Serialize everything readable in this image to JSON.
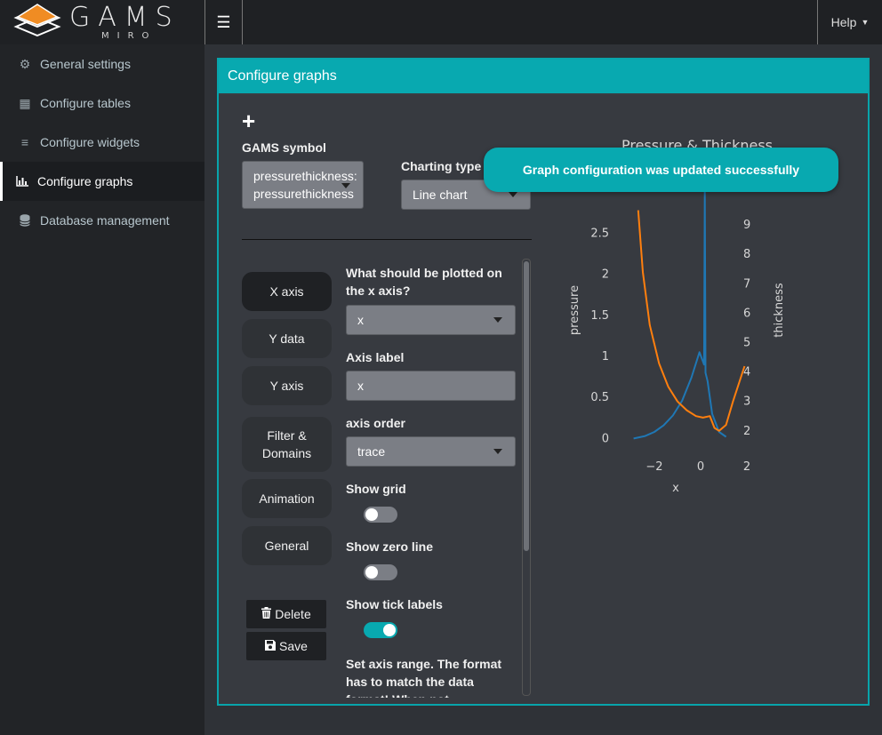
{
  "app": {
    "logo_text": "GAMS",
    "logo_subtext": "MIRO"
  },
  "header": {
    "menu_icon": "hamburger-icon",
    "help_label": "Help"
  },
  "sidebar": {
    "items": [
      {
        "label": "General settings",
        "icon": "gears-icon"
      },
      {
        "label": "Configure tables",
        "icon": "table-icon"
      },
      {
        "label": "Configure widgets",
        "icon": "sliders-icon"
      },
      {
        "label": "Configure graphs",
        "icon": "bar-chart-icon",
        "active": true
      },
      {
        "label": "Database management",
        "icon": "database-icon"
      }
    ]
  },
  "panel": {
    "title": "Configure graphs",
    "add_icon": "+",
    "gams_symbol_label": "GAMS symbol",
    "gams_symbol_value_1": "pressurethickness:",
    "gams_symbol_value_2": "pressurethickness",
    "charting_type_label": "Charting type",
    "charting_type_value": "Line chart"
  },
  "tabs": [
    "X axis",
    "Y data",
    "Y axis",
    "Filter & Domains",
    "Animation",
    "General"
  ],
  "actions": {
    "delete": "Delete",
    "save": "Save"
  },
  "form": {
    "x_axis_question": "What should be plotted on the x axis?",
    "x_axis_value": "x",
    "axis_label_label": "Axis label",
    "axis_label_value": "x",
    "axis_order_label": "axis order",
    "axis_order_value": "trace",
    "show_grid_label": "Show grid",
    "show_grid": false,
    "show_zero_line_label": "Show zero line",
    "show_zero_line": false,
    "show_tick_labels_label": "Show tick labels",
    "show_tick_labels": true,
    "axis_range_label": "Set axis range. The format has to match the data format! When not"
  },
  "toast": {
    "message": "Graph configuration was updated successfully"
  },
  "chart_data": {
    "type": "line",
    "title": "Pressure & Thickness",
    "xlabel": "x",
    "ylabel": "pressure",
    "y2label": "thickness",
    "x_ticks": [
      "−2",
      "0",
      "2"
    ],
    "y_ticks": [
      "0",
      "0.5",
      "1",
      "1.5",
      "2",
      "2.5"
    ],
    "y2_ticks": [
      "2",
      "3",
      "4",
      "5",
      "6",
      "7",
      "8",
      "9"
    ],
    "series": [
      {
        "name": "pressure",
        "axis": "y",
        "color": "#1f77b4",
        "x": [
          -2.9,
          -2.4,
          -2.0,
          -1.6,
          -1.2,
          -0.8,
          -0.4,
          -0.05,
          0.15,
          0.18,
          0.21,
          0.3,
          0.5,
          0.8,
          1.1
        ],
        "y": [
          0.0,
          0.03,
          0.08,
          0.16,
          0.28,
          0.46,
          0.74,
          1.05,
          0.9,
          3.0,
          0.8,
          0.7,
          0.3,
          0.08,
          0.02
        ]
      },
      {
        "name": "thickness",
        "axis": "y2",
        "color": "#ff7f0e",
        "x": [
          -2.7,
          -2.5,
          -2.2,
          -1.8,
          -1.4,
          -1.0,
          -0.6,
          -0.2,
          0.1,
          0.4,
          0.6,
          0.8,
          1.1,
          1.4,
          1.9
        ],
        "y": [
          9.5,
          7.4,
          5.6,
          4.3,
          3.5,
          3.0,
          2.7,
          2.5,
          2.45,
          2.5,
          2.1,
          2.0,
          2.2,
          3.0,
          4.2
        ]
      }
    ]
  }
}
